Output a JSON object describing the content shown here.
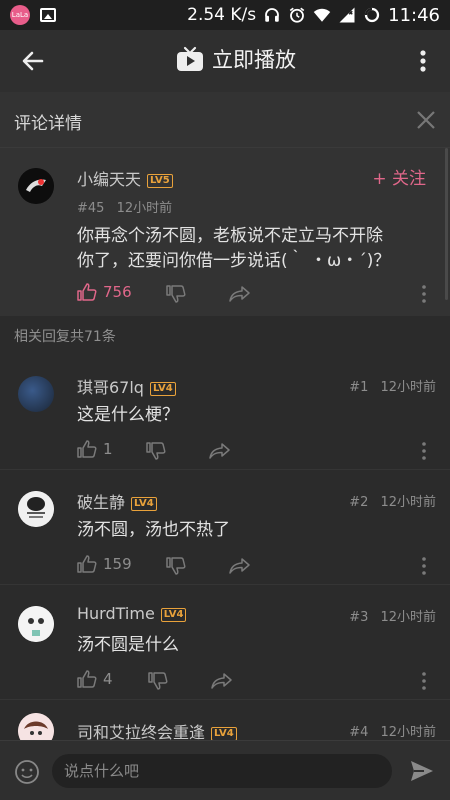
{
  "status_bar": {
    "speed": "2.54 K/s",
    "time": "11:46",
    "app_icon_text": "LaLa"
  },
  "toolbar": {
    "title": "立即播放"
  },
  "detail": {
    "title": "评论详情"
  },
  "main_comment": {
    "user": "小编天天",
    "level": "LV5",
    "floor": "#45",
    "time": "12小时前",
    "follow_label": "+ 关注",
    "text_line1": "你再念个汤不圆，老板说不定立马不开除",
    "text_line2": "你了，还要问你借一步说话(｀ ・ω・´)？",
    "likes": "756"
  },
  "related_label": "相关回复共71条",
  "replies": [
    {
      "user": "琪哥67lq",
      "level": "LV4",
      "floor": "#1",
      "time": "12小时前",
      "text": "这是什么梗？",
      "likes": "1"
    },
    {
      "user": "破生静",
      "level": "LV4",
      "floor": "#2",
      "time": "12小时前",
      "text": "汤不圆，汤也不热了",
      "likes": "159"
    },
    {
      "user": "HurdTime",
      "level": "LV4",
      "floor": "#3",
      "time": "12小时前",
      "text": "汤不圆是什么",
      "likes": "4"
    },
    {
      "user": "司和艾拉终会重逢",
      "level": "LV4",
      "floor": "#4",
      "time": "12小时前"
    }
  ],
  "input": {
    "placeholder": "说点什么吧"
  },
  "colors": {
    "accent": "#e0678a",
    "level": "#e9a23b",
    "background": "#2b2b2b"
  }
}
